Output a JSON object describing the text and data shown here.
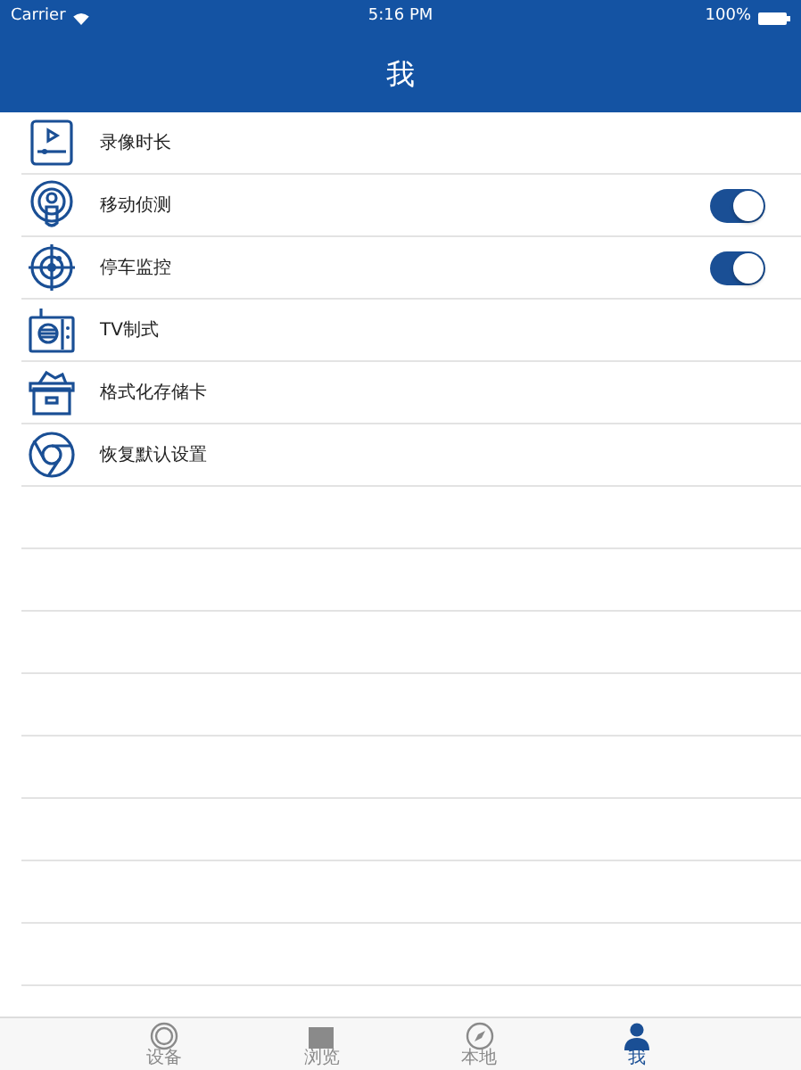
{
  "status_bar": {
    "carrier": "Carrier",
    "time": "5:16 PM",
    "battery": "100%"
  },
  "header": {
    "title": "我"
  },
  "settings": [
    {
      "kind": "video",
      "label": "录像时长"
    },
    {
      "kind": "motion",
      "label": "移动侦测",
      "on": true
    },
    {
      "kind": "radar",
      "label": "停车监控",
      "on": true
    },
    {
      "kind": "tv",
      "label": "TV制式"
    },
    {
      "kind": "box",
      "label": "格式化存储卡"
    },
    {
      "kind": "reset",
      "label": "恢复默认设置"
    }
  ],
  "tab_bar": [
    {
      "kind": "device",
      "label": "设备",
      "selected": false
    },
    {
      "kind": "browse",
      "label": "浏览",
      "selected": false
    },
    {
      "kind": "local",
      "label": "本地",
      "selected": false
    },
    {
      "kind": "me",
      "label": "我",
      "selected": true
    }
  ]
}
